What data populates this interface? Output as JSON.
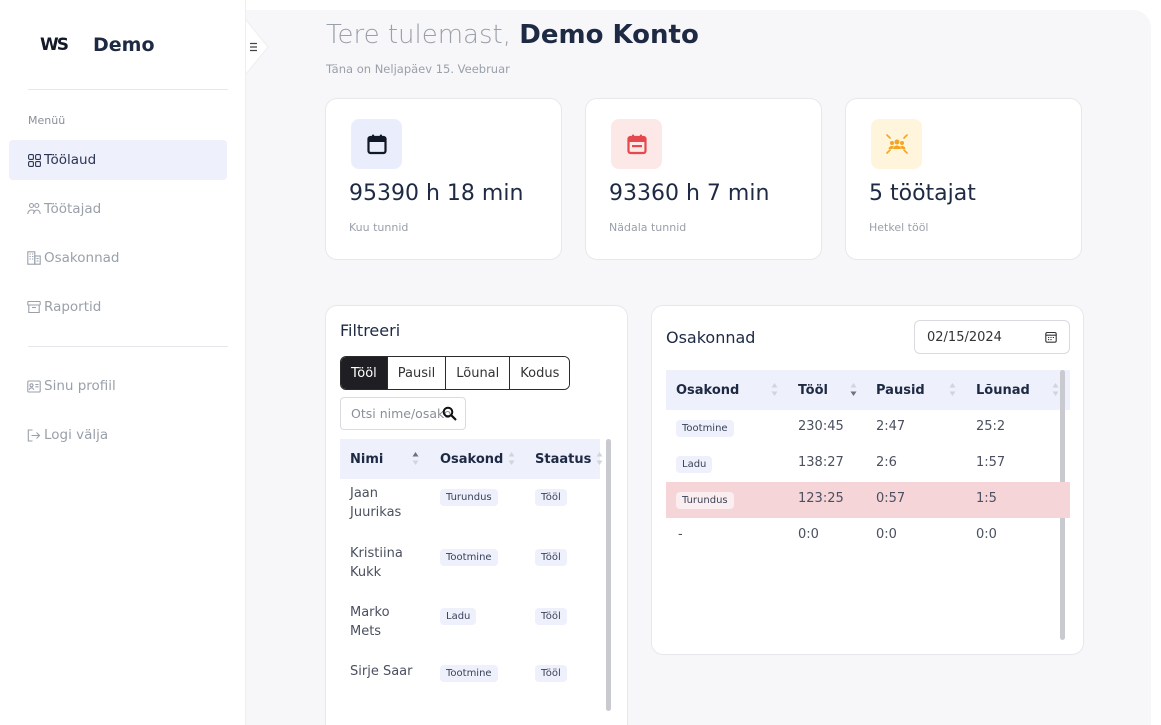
{
  "sidebar": {
    "logo": "WS",
    "brand": "Demo",
    "menu_title": "Menüü",
    "items": [
      {
        "label": "Töölaud",
        "icon": "grid-icon"
      },
      {
        "label": "Töötajad",
        "icon": "users-icon"
      },
      {
        "label": "Osakonnad",
        "icon": "building-icon"
      },
      {
        "label": "Raportid",
        "icon": "archive-icon"
      },
      {
        "label": "Sinu profiil",
        "icon": "id-card-icon"
      },
      {
        "label": "Logi välja",
        "icon": "logout-icon"
      }
    ],
    "active_index": 0
  },
  "header": {
    "greeting_prefix": "Tere tulemast,",
    "greeting_name": "Demo Konto",
    "date_line": "Täna on Neljapäev 15. Veebruar"
  },
  "stats": [
    {
      "value": "95390 h 18 min",
      "label": "Kuu tunnid",
      "icon": "calendar-icon",
      "icon_color": "#111827",
      "bg": "#eaedfb"
    },
    {
      "value": "93360 h 7 min",
      "label": "Nädala tunnid",
      "icon": "calendar-week-icon",
      "icon_color": "#e5484d",
      "bg": "#fde8e8"
    },
    {
      "value": "5 töötajat",
      "label": "Hetkel tööl",
      "icon": "people-group-icon",
      "icon_color": "#f5a524",
      "bg": "#fff5dc"
    }
  ],
  "filter": {
    "title": "Filtreeri",
    "tabs": [
      "Tööl",
      "Pausil",
      "Lõunal",
      "Kodus"
    ],
    "active_tab": 0,
    "search_placeholder": "Otsi nime/osakonda",
    "columns": [
      "Nimi",
      "Osakond",
      "Staatus"
    ],
    "rows": [
      {
        "name_l1": "Jaan",
        "name_l2": "Juurikas",
        "dept": "Turundus",
        "status": "Tööl"
      },
      {
        "name_l1": "Kristiina",
        "name_l2": "Kukk",
        "dept": "Tootmine",
        "status": "Tööl"
      },
      {
        "name_l1": "Marko",
        "name_l2": "Mets",
        "dept": "Ladu",
        "status": "Tööl"
      },
      {
        "name_l1": "Sirje Saar",
        "name_l2": "",
        "dept": "Tootmine",
        "status": "Tööl"
      }
    ]
  },
  "departments": {
    "title": "Osakonnad",
    "date": "02/15/2024",
    "columns": [
      "Osakond",
      "Tööl",
      "Pausid",
      "Lõunad"
    ],
    "rows": [
      {
        "dept": "Tootmine",
        "work": "230:45",
        "breaks": "2:47",
        "lunch": "25:2",
        "highlight": false
      },
      {
        "dept": "Ladu",
        "work": "138:27",
        "breaks": "2:6",
        "lunch": "1:57",
        "highlight": false
      },
      {
        "dept": "Turundus",
        "work": "123:25",
        "breaks": "0:57",
        "lunch": "1:5",
        "highlight": true
      },
      {
        "dept": "-",
        "work": "0:0",
        "breaks": "0:0",
        "lunch": "0:0",
        "highlight": false
      }
    ],
    "highlight_color": "#f6d5d8"
  }
}
